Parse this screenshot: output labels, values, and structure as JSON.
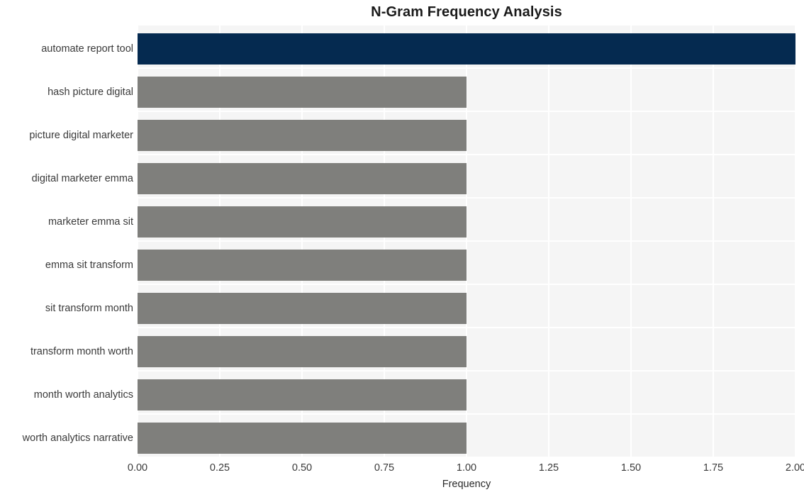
{
  "chart_data": {
    "type": "bar",
    "orientation": "horizontal",
    "title": "N-Gram Frequency Analysis",
    "xlabel": "Frequency",
    "ylabel": "",
    "categories": [
      "automate report tool",
      "hash picture digital",
      "picture digital marketer",
      "digital marketer emma",
      "marketer emma sit",
      "emma sit transform",
      "sit transform month",
      "transform month worth",
      "month worth analytics",
      "worth analytics narrative"
    ],
    "values": [
      2,
      1,
      1,
      1,
      1,
      1,
      1,
      1,
      1,
      1
    ],
    "bar_colors": [
      "#052a50",
      "#7f7f7c",
      "#7f7f7c",
      "#7f7f7c",
      "#7f7f7c",
      "#7f7f7c",
      "#7f7f7c",
      "#7f7f7c",
      "#7f7f7c",
      "#7f7f7c"
    ],
    "xlim": [
      0,
      2.0
    ],
    "x_ticks": [
      0,
      0.25,
      0.5,
      0.75,
      1.0,
      1.25,
      1.5,
      1.75,
      2.0
    ],
    "x_tick_labels": [
      "0.00",
      "0.25",
      "0.50",
      "0.75",
      "1.00",
      "1.25",
      "1.50",
      "1.75",
      "2.00"
    ],
    "grid": true,
    "grid_color": "#ffffff",
    "plot_background": "#f5f5f5",
    "figure_background": "#ffffff",
    "legend": null,
    "highlight_color": "#052a50",
    "base_color": "#7f7f7c"
  }
}
